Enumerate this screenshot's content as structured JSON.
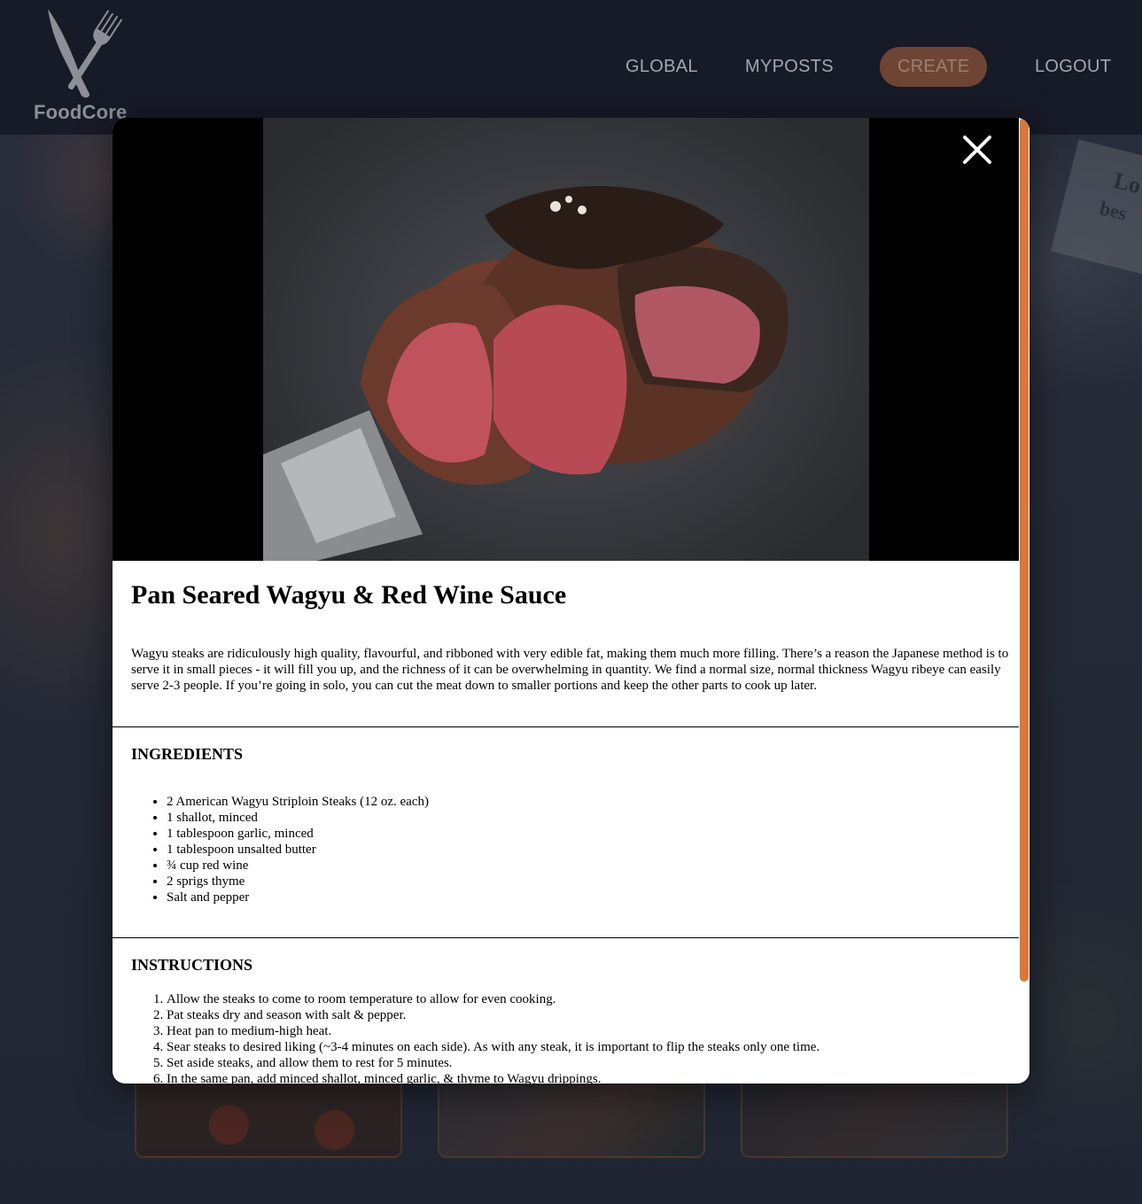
{
  "header": {
    "logo_text": "FoodCore",
    "nav": {
      "global": "GLOBAL",
      "myposts": "MYPOSTS",
      "create": "CREATE",
      "logout": "LOGOUT"
    }
  },
  "background": {
    "paper_text_1": "Lo",
    "paper_text_2": "bes"
  },
  "modal": {
    "close_icon": "close-icon",
    "title": "Pan Seared Wagyu & Red Wine Sauce",
    "description": "Wagyu steaks are ridiculously high quality, flavourful, and ribboned with very edible fat, making them much more filling. There’s a reason the Japanese method is to serve it in small pieces - it will fill you up, and the richness of it can be overwhelming in quantity. We find a normal size, normal thickness Wagyu ribeye can easily serve 2-3 people. If you’re going in solo, you can cut the meat down to smaller portions and keep the other parts to cook up later.",
    "ingredients_title": "INGREDIENTS",
    "ingredients": [
      "2 American Wagyu Striploin Steaks (12 oz. each)",
      "1 shallot, minced",
      "1 tablespoon garlic, minced",
      "1 tablespoon unsalted butter",
      "¾ cup red wine",
      "2 sprigs thyme",
      "Salt and pepper"
    ],
    "instructions_title": "INSTRUCTIONS",
    "instructions": [
      "Allow the steaks to come to room temperature to allow for even cooking.",
      "Pat steaks dry and season with salt & pepper.",
      "Heat pan to medium-high heat.",
      "Sear steaks to desired liking (~3-4 minutes on each side). As with any steak, it is important to flip the steaks only one time.",
      "Set aside steaks, and allow them to rest for 5 minutes.",
      "In the same pan, add minced shallot, minced garlic, & thyme to Wagyu drippings."
    ]
  },
  "colors": {
    "accent": "#d8783a",
    "create_button": "#6e4534",
    "header_bg": "#161926"
  }
}
